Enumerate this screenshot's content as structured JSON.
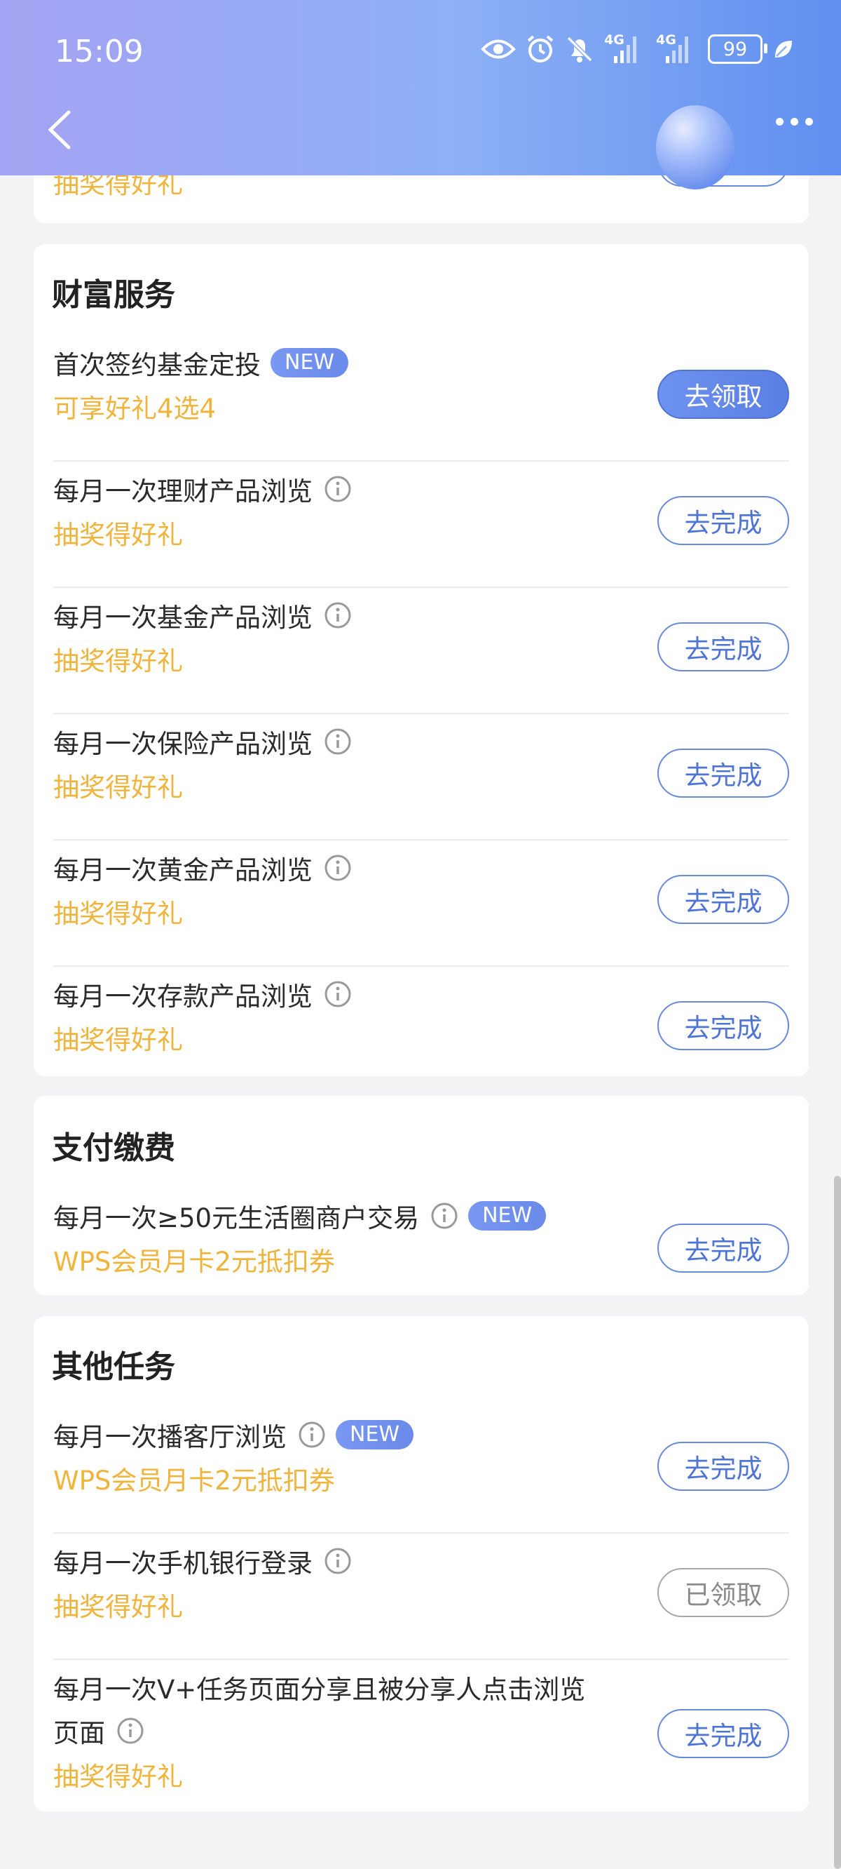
{
  "status_bar": {
    "time": "15:09",
    "network1": "4G",
    "network2": "4G",
    "battery": "99"
  },
  "prev_card": {
    "reward": "抽奖得好礼"
  },
  "wealth": {
    "title": "财富服务",
    "items": [
      {
        "name": "首次签约基金定投",
        "badge": "NEW",
        "reward": "可享好礼4选4",
        "button": "去领取"
      },
      {
        "name": "每月一次理财产品浏览",
        "reward": "抽奖得好礼",
        "button": "去完成"
      },
      {
        "name": "每月一次基金产品浏览",
        "reward": "抽奖得好礼",
        "button": "去完成"
      },
      {
        "name": "每月一次保险产品浏览",
        "reward": "抽奖得好礼",
        "button": "去完成"
      },
      {
        "name": "每月一次黄金产品浏览",
        "reward": "抽奖得好礼",
        "button": "去完成"
      },
      {
        "name": "每月一次存款产品浏览",
        "reward": "抽奖得好礼",
        "button": "去完成"
      }
    ]
  },
  "payment": {
    "title": "支付缴费",
    "items": [
      {
        "name": "每月一次≥50元生活圈商户交易",
        "badge": "NEW",
        "reward": "WPS会员月卡2元抵扣券",
        "button": "去完成"
      }
    ]
  },
  "other": {
    "title": "其他任务",
    "items": [
      {
        "name": "每月一次播客厅浏览",
        "badge": "NEW",
        "reward": "WPS会员月卡2元抵扣券",
        "button": "去完成"
      },
      {
        "name": "每月一次手机银行登录",
        "reward": "抽奖得好礼",
        "button": "已领取"
      },
      {
        "name_line1": "每月一次V+任务页面分享且被分享人点击浏览",
        "name_line2": "页面",
        "reward": "抽奖得好礼",
        "button": "去完成"
      }
    ]
  },
  "colors": {
    "accent": "#5a7fe3",
    "reward": "#efb43c",
    "header_start": "#a5a3f3",
    "header_end": "#5f8ff0"
  }
}
